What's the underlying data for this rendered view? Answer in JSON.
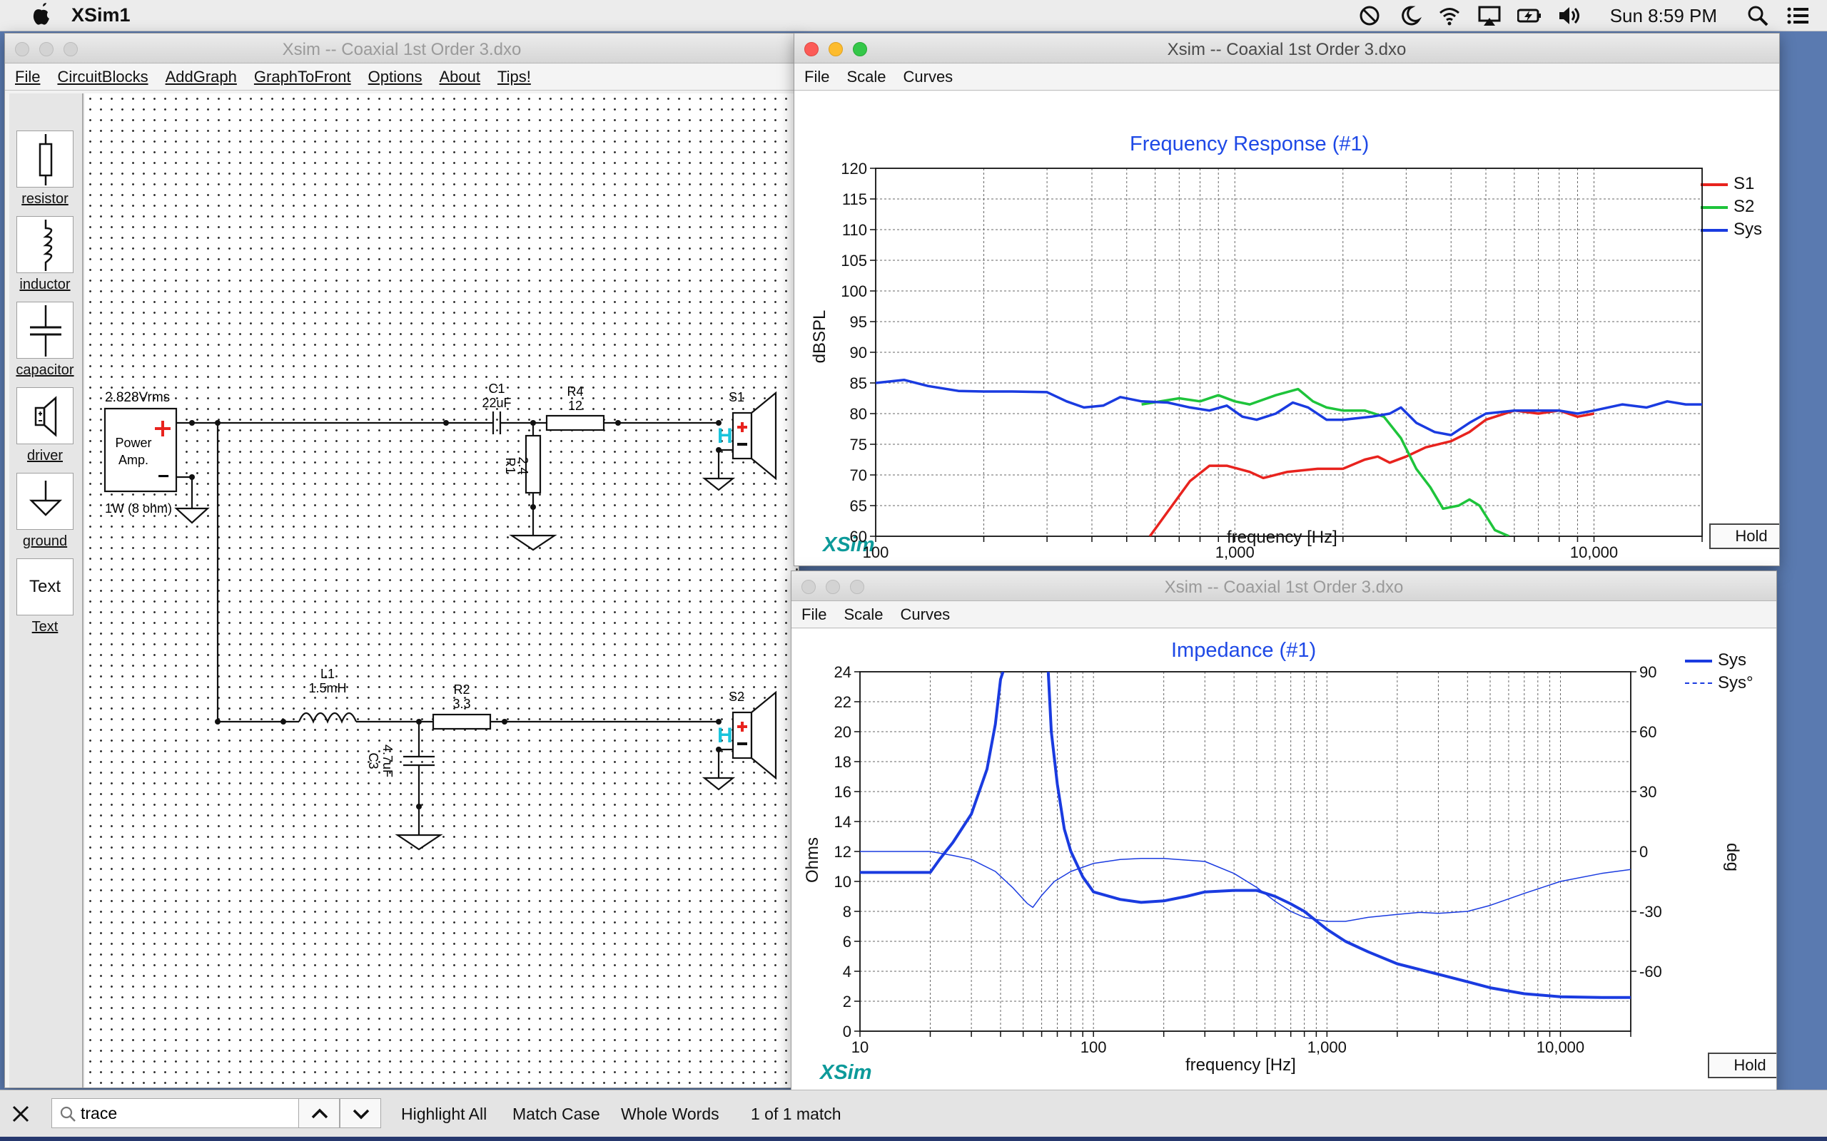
{
  "menubar": {
    "app": "XSim1",
    "clock": "Sun 8:59 PM",
    "icons": [
      "siri-disabled-icon",
      "night-shift-icon",
      "wifi-icon",
      "airplay-icon",
      "battery-charging-icon",
      "volume-icon",
      "spotlight-icon",
      "notification-center-icon"
    ]
  },
  "schematic_window": {
    "title": "Xsim -- Coaxial 1st Order 3.dxo",
    "menu": [
      "File",
      "CircuitBlocks",
      "AddGraph",
      "GraphToFront",
      "Options",
      "About",
      "Tips!"
    ],
    "tools": [
      "resistor",
      "inductor",
      "capacitor",
      "driver",
      "ground",
      "Text"
    ],
    "tool_text_glyph": "Text",
    "amp": {
      "voltage": "2.828Vrms",
      "line1": "Power",
      "line2": "Amp.",
      "rating": "1W (8 ohm)",
      "plus": "+",
      "minus": "−"
    },
    "components": {
      "c1": {
        "name": "C1",
        "value": "22uF"
      },
      "r4": {
        "name": "R4",
        "value": "12"
      },
      "r1": {
        "name": "R1",
        "value": "2.4"
      },
      "l1": {
        "name": "L1",
        "value": "1.5mH"
      },
      "r2": {
        "name": "R2",
        "value": "3.3"
      },
      "c3": {
        "name": "C3",
        "value": "4.7uF"
      },
      "s1": {
        "name": "S1",
        "h": "H"
      },
      "s2": {
        "name": "S2",
        "h": "H"
      }
    }
  },
  "freq_window": {
    "title": "Xsim -- Coaxial 1st Order 3.dxo",
    "menu": [
      "File",
      "Scale",
      "Curves"
    ],
    "plot_title": "Frequency Response (#1)",
    "ylabel": "dBSPL",
    "xlabel": "frequency [Hz]",
    "logo": "XSim",
    "hold": "Hold",
    "legend": [
      {
        "name": "S1",
        "color": "#e8231e"
      },
      {
        "name": "S2",
        "color": "#1ec43b"
      },
      {
        "name": "Sys",
        "color": "#1a3be0"
      }
    ]
  },
  "imp_window": {
    "title": "Xsim -- Coaxial 1st Order 3.dxo",
    "menu": [
      "File",
      "Scale",
      "Curves"
    ],
    "plot_title": "Impedance (#1)",
    "ylabel": "Ohms",
    "y2label": "deg",
    "xlabel": "frequency [Hz]",
    "logo": "XSim",
    "hold": "Hold",
    "legend": [
      {
        "name": "Sys",
        "color": "#1a3be0",
        "style": "solid"
      },
      {
        "name": "Sys°",
        "color": "#1a3be0",
        "style": "dashed"
      }
    ]
  },
  "findbar": {
    "query": "trace",
    "highlight_all": "Highlight All",
    "match_case": "Match Case",
    "whole_words": "Whole Words",
    "status": "1 of 1 match"
  },
  "chart_data": [
    {
      "type": "line",
      "title": "Frequency Response (#1)",
      "xlabel": "frequency [Hz]",
      "ylabel": "dBSPL",
      "xscale": "log",
      "xlim": [
        100,
        20000
      ],
      "ylim": [
        60,
        120
      ],
      "yticks": [
        60,
        65,
        70,
        75,
        80,
        85,
        90,
        95,
        100,
        105,
        110,
        115,
        120
      ],
      "xtick_labels": [
        {
          "v": 100,
          "t": "100"
        },
        {
          "v": 1000,
          "t": "1,000"
        },
        {
          "v": 10000,
          "t": "10,000"
        }
      ],
      "grid": true,
      "legend": "top-right",
      "series": [
        {
          "name": "S1",
          "color": "#e8231e",
          "width": 3.5,
          "points": [
            [
              580,
              60
            ],
            [
              650,
              64
            ],
            [
              750,
              69
            ],
            [
              850,
              71.5
            ],
            [
              950,
              71.5
            ],
            [
              1100,
              70.5
            ],
            [
              1200,
              69.5
            ],
            [
              1400,
              70.5
            ],
            [
              1700,
              71
            ],
            [
              2000,
              71
            ],
            [
              2300,
              72.5
            ],
            [
              2500,
              73
            ],
            [
              2700,
              72
            ],
            [
              3000,
              73
            ],
            [
              3400,
              74.5
            ],
            [
              4000,
              75.5
            ],
            [
              4500,
              77
            ],
            [
              5000,
              79
            ],
            [
              6000,
              80.5
            ],
            [
              7000,
              80
            ],
            [
              8000,
              80.5
            ],
            [
              9000,
              79.5
            ],
            [
              10000,
              80
            ]
          ]
        },
        {
          "name": "S2",
          "color": "#1ec43b",
          "width": 3.5,
          "points": [
            [
              550,
              81.5
            ],
            [
              700,
              82.5
            ],
            [
              800,
              82
            ],
            [
              900,
              83
            ],
            [
              1000,
              82
            ],
            [
              1100,
              81.5
            ],
            [
              1300,
              83
            ],
            [
              1500,
              84
            ],
            [
              1650,
              82
            ],
            [
              1800,
              81
            ],
            [
              2000,
              80.5
            ],
            [
              2300,
              80.5
            ],
            [
              2600,
              79.5
            ],
            [
              2900,
              76
            ],
            [
              3200,
              71
            ],
            [
              3500,
              68
            ],
            [
              3800,
              64.5
            ],
            [
              4200,
              65
            ],
            [
              4500,
              66
            ],
            [
              4800,
              65
            ],
            [
              5300,
              61
            ],
            [
              5800,
              60
            ]
          ]
        },
        {
          "name": "Sys",
          "color": "#1a3be0",
          "width": 3.5,
          "points": [
            [
              100,
              85
            ],
            [
              120,
              85.5
            ],
            [
              140,
              84.5
            ],
            [
              170,
              83.7
            ],
            [
              200,
              83.6
            ],
            [
              240,
              83.6
            ],
            [
              300,
              83.5
            ],
            [
              340,
              82
            ],
            [
              380,
              81
            ],
            [
              430,
              81.3
            ],
            [
              480,
              82.7
            ],
            [
              550,
              82
            ],
            [
              650,
              81.8
            ],
            [
              750,
              81
            ],
            [
              850,
              80.5
            ],
            [
              950,
              81.3
            ],
            [
              1050,
              79.5
            ],
            [
              1150,
              79
            ],
            [
              1300,
              80
            ],
            [
              1450,
              81.8
            ],
            [
              1600,
              81
            ],
            [
              1800,
              79
            ],
            [
              2000,
              79
            ],
            [
              2400,
              79.5
            ],
            [
              2700,
              80
            ],
            [
              2900,
              81
            ],
            [
              3200,
              78.5
            ],
            [
              3600,
              77
            ],
            [
              4000,
              76.5
            ],
            [
              4500,
              78.5
            ],
            [
              5000,
              80
            ],
            [
              6000,
              80.5
            ],
            [
              8000,
              80.5
            ],
            [
              9000,
              80
            ],
            [
              10000,
              80.5
            ],
            [
              12000,
              81.5
            ],
            [
              14000,
              81
            ],
            [
              16000,
              82
            ],
            [
              18000,
              81.5
            ],
            [
              20000,
              81.5
            ]
          ]
        }
      ]
    },
    {
      "type": "line",
      "title": "Impedance (#1)",
      "xlabel": "frequency [Hz]",
      "ylabel": "Ohms",
      "y2label": "deg",
      "xscale": "log",
      "xlim": [
        10,
        20000
      ],
      "ylim": [
        0,
        24
      ],
      "y2lim": [
        -90,
        90
      ],
      "yticks": [
        0,
        2,
        4,
        6,
        8,
        10,
        12,
        14,
        16,
        18,
        20,
        22,
        24
      ],
      "y2ticks": [
        -60,
        -30,
        0,
        30,
        60,
        90
      ],
      "xtick_labels": [
        {
          "v": 10,
          "t": "10"
        },
        {
          "v": 100,
          "t": "100"
        },
        {
          "v": 1000,
          "t": "1,000"
        },
        {
          "v": 10000,
          "t": "10,000"
        }
      ],
      "grid": true,
      "legend": "top-right",
      "series": [
        {
          "name": "Sys",
          "axis": "y",
          "color": "#1a3be0",
          "width": 4,
          "points": [
            [
              10,
              10.6
            ],
            [
              15,
              10.6
            ],
            [
              20,
              10.6
            ],
            [
              22,
              11.5
            ],
            [
              25,
              12.6
            ],
            [
              30,
              14.5
            ],
            [
              35,
              17.5
            ],
            [
              38,
              20.5
            ],
            [
              40,
              23.5
            ],
            [
              41,
              24
            ]
          ],
          "points2": [
            [
              64,
              24
            ],
            [
              66,
              20
            ],
            [
              70,
              16.5
            ],
            [
              75,
              13.5
            ],
            [
              80,
              12
            ],
            [
              90,
              10.3
            ],
            [
              100,
              9.3
            ],
            [
              130,
              8.8
            ],
            [
              160,
              8.6
            ],
            [
              200,
              8.7
            ],
            [
              250,
              9
            ],
            [
              300,
              9.3
            ],
            [
              400,
              9.4
            ],
            [
              500,
              9.4
            ],
            [
              600,
              9
            ],
            [
              700,
              8.5
            ],
            [
              800,
              8
            ],
            [
              1000,
              6.8
            ],
            [
              1200,
              6
            ],
            [
              1500,
              5.3
            ],
            [
              2000,
              4.5
            ],
            [
              3000,
              3.8
            ],
            [
              4000,
              3.3
            ],
            [
              5000,
              2.9
            ],
            [
              7000,
              2.5
            ],
            [
              10000,
              2.3
            ],
            [
              15000,
              2.25
            ],
            [
              20000,
              2.25
            ]
          ]
        },
        {
          "name": "Sys°",
          "axis": "y2",
          "color": "#1a3be0",
          "width": 1.5,
          "points": [
            [
              10,
              0
            ],
            [
              20,
              0
            ],
            [
              25,
              -2
            ],
            [
              30,
              -4
            ],
            [
              38,
              -10
            ],
            [
              45,
              -18
            ],
            [
              52,
              -26
            ],
            [
              55,
              -28
            ],
            [
              60,
              -22
            ],
            [
              68,
              -15
            ],
            [
              80,
              -10
            ],
            [
              100,
              -6
            ],
            [
              130,
              -4
            ],
            [
              160,
              -3.5
            ],
            [
              200,
              -3.5
            ],
            [
              300,
              -5
            ],
            [
              400,
              -11
            ],
            [
              500,
              -18
            ],
            [
              600,
              -25
            ],
            [
              700,
              -30
            ],
            [
              800,
              -33
            ],
            [
              1000,
              -35
            ],
            [
              1200,
              -35
            ],
            [
              1500,
              -33
            ],
            [
              2000,
              -31.5
            ],
            [
              2500,
              -30.5
            ],
            [
              3000,
              -31
            ],
            [
              4000,
              -30
            ],
            [
              5000,
              -27
            ],
            [
              7000,
              -21
            ],
            [
              10000,
              -15
            ],
            [
              15000,
              -11
            ],
            [
              20000,
              -9
            ]
          ]
        }
      ]
    }
  ]
}
